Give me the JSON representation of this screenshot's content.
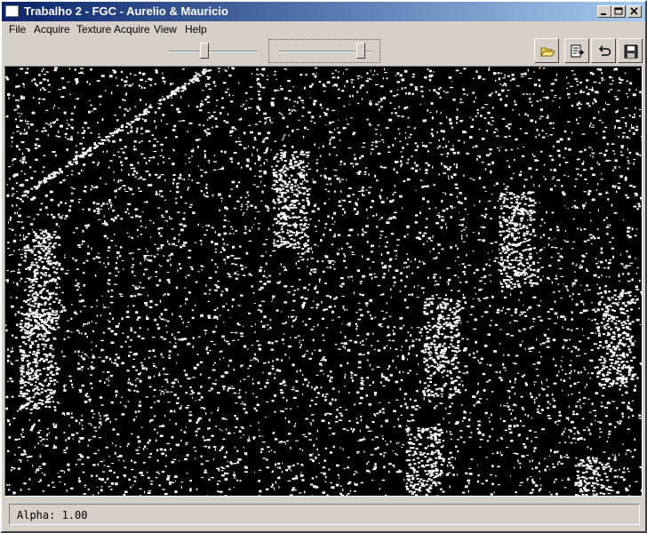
{
  "window": {
    "title": "Trabalho 2 - FGC - Aurelio & Mauricio"
  },
  "menu": {
    "items": [
      "File",
      "Acquire",
      "Texture Acquire",
      "View",
      "Help"
    ]
  },
  "toolbar": {
    "slider1_value": 0.4,
    "slider2_value": 0.88,
    "buttons": [
      "open-folder-icon",
      "export-icon",
      "undo-icon",
      "save-icon"
    ]
  },
  "status": {
    "text": "Alpha: 1.00"
  },
  "colors": {
    "titlebar_start": "#0a246a",
    "titlebar_end": "#a6caf0",
    "face": "#d4d0c8"
  }
}
